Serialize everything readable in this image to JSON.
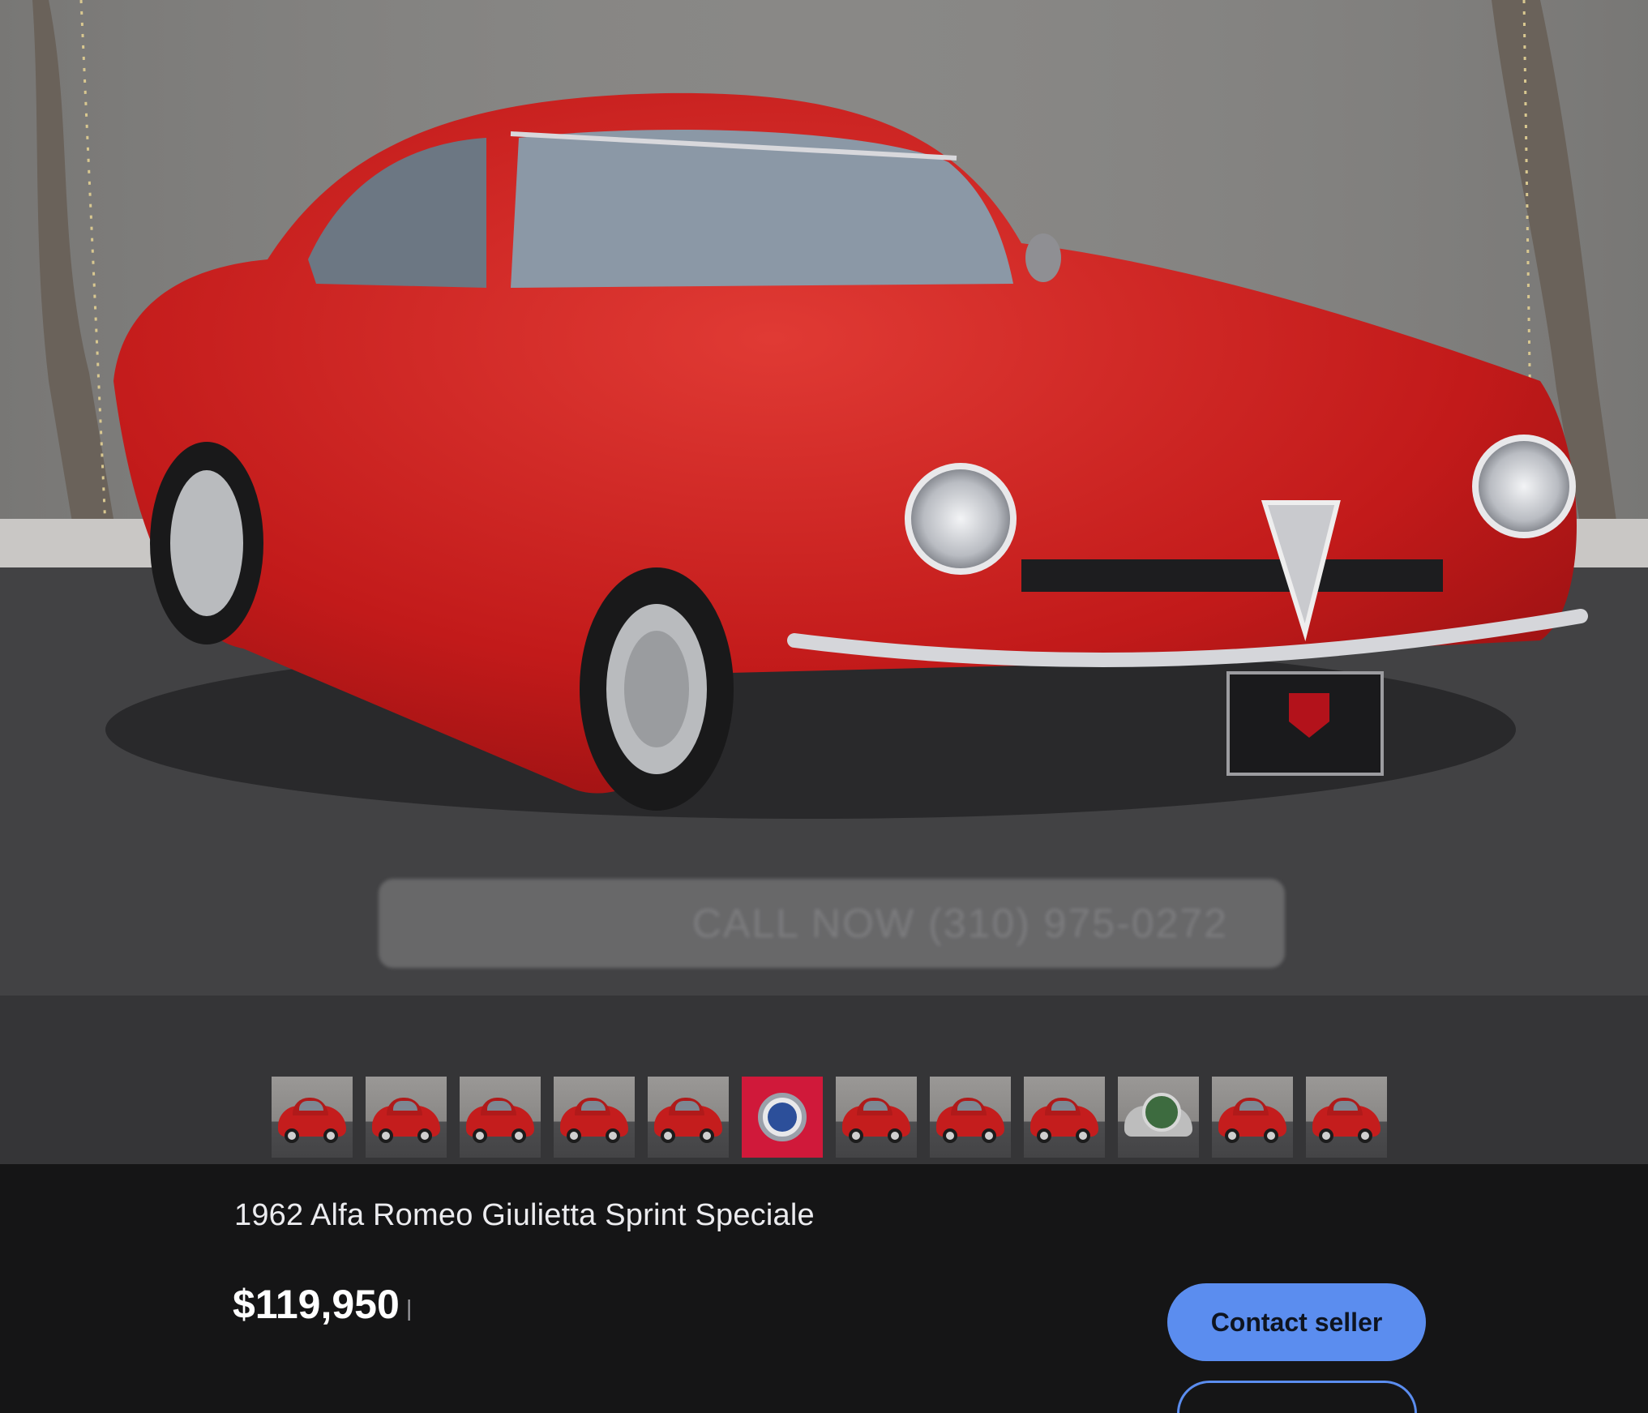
{
  "hero": {
    "image_alt": "Red classic coupe parked on asphalt in front of a concrete wall",
    "watermark_text": "CALL NOW (310) 975-0272"
  },
  "thumbnails": [
    {
      "kind": "car",
      "name": "thumb-1"
    },
    {
      "kind": "car",
      "name": "thumb-2"
    },
    {
      "kind": "car",
      "name": "thumb-3"
    },
    {
      "kind": "car",
      "name": "thumb-4"
    },
    {
      "kind": "car",
      "name": "thumb-5"
    },
    {
      "kind": "badge",
      "name": "thumb-6"
    },
    {
      "kind": "car",
      "name": "thumb-7"
    },
    {
      "kind": "car",
      "name": "thumb-8"
    },
    {
      "kind": "car",
      "name": "thumb-9"
    },
    {
      "kind": "grille",
      "name": "thumb-10"
    },
    {
      "kind": "car",
      "name": "thumb-11"
    },
    {
      "kind": "car",
      "name": "thumb-12"
    }
  ],
  "listing": {
    "title": "1962 Alfa Romeo Giulietta Sprint Speciale",
    "price": "$119,950",
    "price_separator": "|",
    "contact_label": "Contact seller"
  },
  "colors": {
    "accent": "#5b8def",
    "panel_bg": "#151516",
    "strip_bg": "#353537",
    "car_red": "#c41d1d"
  }
}
